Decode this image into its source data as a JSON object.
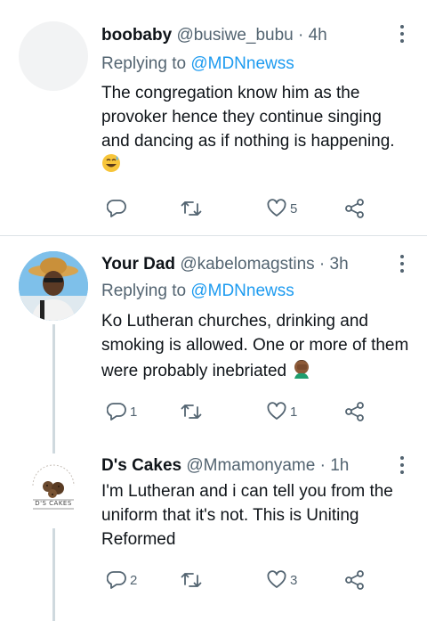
{
  "tweets": [
    {
      "name": "boobaby",
      "handle": "@busiwe_bubu",
      "separator": "·",
      "time": "4h",
      "replying_prefix": "Replying to",
      "replying_mention": "@MDNnewss",
      "text": "The congregation know him as the provoker hence they continue singing and dancing as if nothing is happening.",
      "emoji": "grinning-sweat-face",
      "reply_count": "",
      "retweet_count": "",
      "like_count": "5"
    },
    {
      "name": "Your Dad",
      "handle": "@kabelomagstins",
      "separator": "·",
      "time": "3h",
      "replying_prefix": "Replying to",
      "replying_mention": "@MDNnewss",
      "text": "Ko Lutheran churches, drinking and smoking is allowed. One or more of them were probably inebriated",
      "emoji": "face-palm",
      "reply_count": "1",
      "retweet_count": "",
      "like_count": "1"
    },
    {
      "name": "D's Cakes",
      "handle": "@Mmamonyame",
      "separator": "·",
      "time": "1h",
      "text": "I'm Lutheran and i can tell you from the uniform that it's not. This is Uniting Reformed",
      "avatar_text": "D'S CAKES",
      "reply_count": "2",
      "retweet_count": "",
      "like_count": "3"
    }
  ],
  "colors": {
    "accent": "#1d9bf0",
    "secondary_text": "#536471",
    "thread_line": "#cfd9de",
    "divider": "#dde3e7"
  }
}
